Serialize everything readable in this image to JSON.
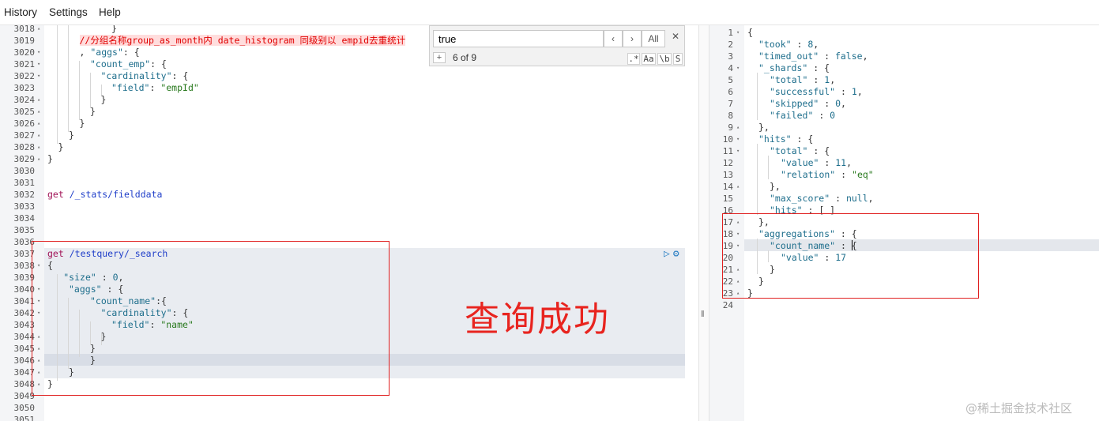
{
  "menu": {
    "history": "History",
    "settings": "Settings",
    "help": "Help"
  },
  "find": {
    "query": "true",
    "prev_label": "‹",
    "next_label": "›",
    "all_label": "All",
    "close_label": "✕",
    "plus_label": "+",
    "count": "6 of 9",
    "regex_label": ".*",
    "case_label": "Aa",
    "word_label": "\\b",
    "selection_label": "S"
  },
  "request_panel": {
    "lines": [
      {
        "num": "3018",
        "fold": "▴"
      },
      {
        "num": "3019",
        "fold": ""
      },
      {
        "num": "3020",
        "fold": "▾"
      },
      {
        "num": "3021",
        "fold": "▾"
      },
      {
        "num": "3022",
        "fold": "▾"
      },
      {
        "num": "3023",
        "fold": ""
      },
      {
        "num": "3024",
        "fold": "▴"
      },
      {
        "num": "3025",
        "fold": "▴"
      },
      {
        "num": "3026",
        "fold": "▴"
      },
      {
        "num": "3027",
        "fold": "▴"
      },
      {
        "num": "3028",
        "fold": "▴"
      },
      {
        "num": "3029",
        "fold": "▴"
      },
      {
        "num": "3030",
        "fold": ""
      },
      {
        "num": "3031",
        "fold": ""
      },
      {
        "num": "3032",
        "fold": ""
      },
      {
        "num": "3033",
        "fold": ""
      },
      {
        "num": "3034",
        "fold": ""
      },
      {
        "num": "3035",
        "fold": ""
      },
      {
        "num": "3036",
        "fold": ""
      },
      {
        "num": "3037",
        "fold": ""
      },
      {
        "num": "3038",
        "fold": "▾"
      },
      {
        "num": "3039",
        "fold": ""
      },
      {
        "num": "3040",
        "fold": "▾"
      },
      {
        "num": "3041",
        "fold": "▾"
      },
      {
        "num": "3042",
        "fold": "▾"
      },
      {
        "num": "3043",
        "fold": ""
      },
      {
        "num": "3044",
        "fold": "▴"
      },
      {
        "num": "3045",
        "fold": "▴"
      },
      {
        "num": "3046",
        "fold": "▴"
      },
      {
        "num": "3047",
        "fold": "▴"
      },
      {
        "num": "3048",
        "fold": "▴"
      },
      {
        "num": "3049",
        "fold": ""
      },
      {
        "num": "3050",
        "fold": ""
      },
      {
        "num": "3051",
        "fold": ""
      }
    ],
    "code": {
      "l3018": "}",
      "l3019_comment": "//分组名称group_as_month内 date_histogram 同级别以 empid去重统计",
      "l3020_pre": ", ",
      "l3020_key": "\"aggs\"",
      "l3020_post": ": {",
      "l3021_key": "\"count_emp\"",
      "l3021_post": ": {",
      "l3022_key": "\"cardinality\"",
      "l3022_post": ": {",
      "l3023_key": "\"field\"",
      "l3023_sep": ": ",
      "l3023_val": "\"empId\"",
      "close": "}",
      "l3032_method": "get",
      "l3032_path": "/_stats/fielddata",
      "l3037_method": "get",
      "l3037_path": "/testquery/_search",
      "open": "{",
      "l3039_key": "\"size\"",
      "l3039_sep": " : ",
      "l3039_val": "0",
      "l3039_post": ",",
      "l3040_key": "\"aggs\"",
      "l3040_post": " : {",
      "l3041_key": "\"count_name\"",
      "l3041_post": ":{",
      "l3042_key": "\"cardinality\"",
      "l3042_post": ": {",
      "l3043_key": "\"field\"",
      "l3043_sep": ": ",
      "l3043_val": "\"name\""
    }
  },
  "response_panel": {
    "lines": [
      {
        "num": "1",
        "fold": "▾"
      },
      {
        "num": "2",
        "fold": ""
      },
      {
        "num": "3",
        "fold": ""
      },
      {
        "num": "4",
        "fold": "▾"
      },
      {
        "num": "5",
        "fold": ""
      },
      {
        "num": "6",
        "fold": ""
      },
      {
        "num": "7",
        "fold": ""
      },
      {
        "num": "8",
        "fold": ""
      },
      {
        "num": "9",
        "fold": "▴"
      },
      {
        "num": "10",
        "fold": "▾"
      },
      {
        "num": "11",
        "fold": "▾"
      },
      {
        "num": "12",
        "fold": ""
      },
      {
        "num": "13",
        "fold": ""
      },
      {
        "num": "14",
        "fold": "▴"
      },
      {
        "num": "15",
        "fold": ""
      },
      {
        "num": "16",
        "fold": ""
      },
      {
        "num": "17",
        "fold": "▴"
      },
      {
        "num": "18",
        "fold": "▾"
      },
      {
        "num": "19",
        "fold": "▾"
      },
      {
        "num": "20",
        "fold": ""
      },
      {
        "num": "21",
        "fold": "▴"
      },
      {
        "num": "22",
        "fold": "▴"
      },
      {
        "num": "23",
        "fold": "▴"
      },
      {
        "num": "24",
        "fold": ""
      }
    ],
    "code": {
      "open": "{",
      "took_key": "\"took\"",
      "took_val": "8",
      "timed_out_key": "\"timed_out\"",
      "timed_out_val": "false",
      "shards_key": "\"_shards\"",
      "total_key": "\"total\"",
      "total_val": "1",
      "successful_key": "\"successful\"",
      "successful_val": "1",
      "skipped_key": "\"skipped\"",
      "skipped_val": "0",
      "failed_key": "\"failed\"",
      "failed_val": "0",
      "hits_key": "\"hits\"",
      "hits_total_key": "\"total\"",
      "value_key": "\"value\"",
      "value_val": "11",
      "relation_key": "\"relation\"",
      "relation_val": "\"eq\"",
      "max_score_key": "\"max_score\"",
      "max_score_val": "null",
      "hits_inner_key": "\"hits\"",
      "hits_inner_val": "[ ]",
      "aggregations_key": "\"aggregations\"",
      "count_name_key": "\"count_name\"",
      "agg_value_key": "\"value\"",
      "agg_value_val": "17",
      "sep": " : ",
      "comma": ",",
      "brace_open": "{",
      "close": "}",
      "close_comma": "},"
    }
  },
  "annotation": {
    "text": "查询成功",
    "color": "#e8241f"
  },
  "watermark": "@稀土掘金技术社区",
  "splitter_label": "‖",
  "colors": {
    "key": "#1e6e8c",
    "string": "#2a7a1f",
    "method": "#a11357",
    "comment": "#e00000",
    "highlight_box": "#e02020"
  }
}
